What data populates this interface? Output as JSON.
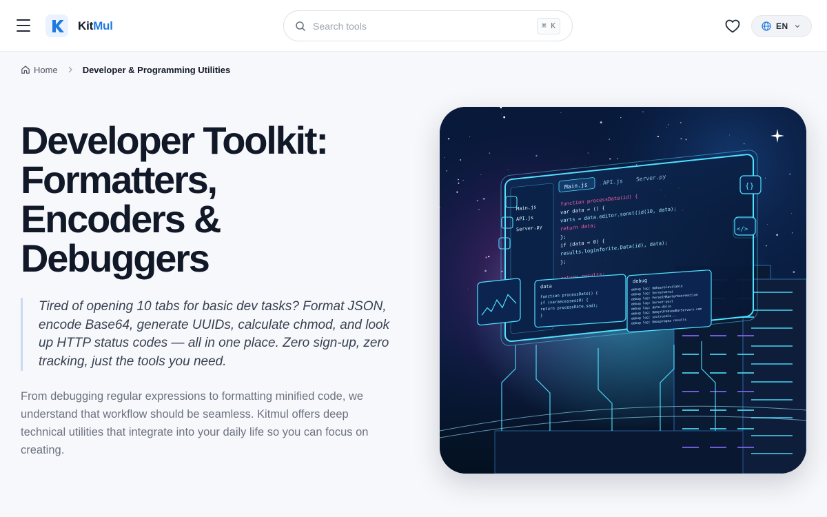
{
  "header": {
    "logo_text_main": "Kit",
    "logo_text_accent": "Mul",
    "search": {
      "placeholder": "Search tools",
      "value": "",
      "shortcut": "⌘ K"
    },
    "language": {
      "code": "EN"
    }
  },
  "breadcrumb": {
    "home_label": "Home",
    "current_label": "Developer & Programming Utilities"
  },
  "hero": {
    "title_lines": [
      "Developer Toolkit:",
      "Formatters,",
      "Encoders &",
      "Debuggers"
    ],
    "quote": "Tired of opening 10 tabs for basic dev tasks? Format JSON, encode Base64, generate UUIDs, calculate chmod, and look up HTTP status codes — all in one place. Zero sign-up, zero tracking, just the tools you need.",
    "description": "From debugging regular expressions to formatting minified code, we understand that workflow should be seamless. Kitmul offers deep technical utilities that integrate into your daily life so you can focus on creating."
  },
  "image": {
    "tabs": [
      "Main.js",
      "API.js",
      "Server.py"
    ],
    "files": [
      "Main.js",
      "API.js",
      "Server.py"
    ],
    "code_lines": [
      "function processData(id) {",
      "  var data = () {",
      "    varts = data.editor.sonst(id(10, data);",
      "    return data;",
      "  };",
      "  if (data = 0) {",
      "    results.loginforite.Data(id), data);",
      "  };",
      "",
      "  return results;",
      "}"
    ],
    "panel_data_title": "data",
    "panel_data_code": [
      "function processDate() {",
      "  if (varaecessess0) {",
      "  return processDate.sad);",
      "}"
    ],
    "panel_debug_title": "debug",
    "panel_debug_lines": [
      "debug log: Umhoerelavilable",
      "debug log: Serverwerai",
      "debug log: FeroelHRanterbeereection",
      "debug log: Server-post",
      "debug log: data-dalie",
      "debug log: UmmyrUrebsewBarServers.com",
      "debug log: snctrosmle...",
      "debug log: Umaupragea results"
    ],
    "side_icons": [
      "{}",
      "</>"
    ],
    "colors": {
      "neon": "#4fe3ff",
      "space": "#06122a",
      "code_keyword": "#ff5fa8",
      "code_text": "#d8f3ff"
    }
  },
  "colors": {
    "accent": "#1f7ae0",
    "title": "#111827",
    "quote_border": "#c9d9f2"
  }
}
